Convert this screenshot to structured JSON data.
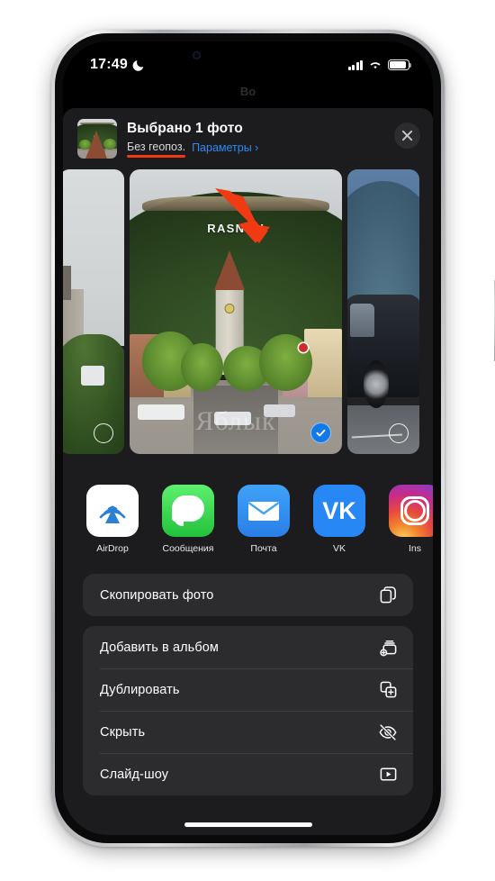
{
  "status_bar": {
    "time": "17:49",
    "dnd_icon": "moon-icon",
    "signal_icon": "cellular-signal-icon",
    "wifi_icon": "wifi-icon",
    "battery_icon": "battery-icon"
  },
  "backdrop": {
    "title": "Во"
  },
  "share_sheet": {
    "title": "Выбрано 1 фото",
    "geo_status": "Без геопоз.",
    "options_link": "Параметры ›",
    "close_icon": "close-icon",
    "thumbnail_name": "selected-photo-thumbnail"
  },
  "photo_strip": {
    "photos": [
      {
        "name": "photo-previous",
        "selected": false,
        "caption": ""
      },
      {
        "name": "photo-rasnov",
        "selected": true,
        "caption": "RASNOV",
        "watermark": "Яблык"
      },
      {
        "name": "photo-next",
        "selected": false,
        "caption": ""
      }
    ]
  },
  "apps": [
    {
      "label": "AirDrop",
      "icon": "airdrop-icon"
    },
    {
      "label": "Сообщения",
      "icon": "messages-icon"
    },
    {
      "label": "Почта",
      "icon": "mail-icon"
    },
    {
      "label": "VK",
      "icon": "vk-icon",
      "glyph": "VK"
    },
    {
      "label": "Ins",
      "icon": "instagram-icon"
    }
  ],
  "action_groups": [
    {
      "rows": [
        {
          "label": "Скопировать фото",
          "icon": "copy-icon"
        }
      ]
    },
    {
      "rows": [
        {
          "label": "Добавить в альбом",
          "icon": "add-to-album-icon"
        },
        {
          "label": "Дублировать",
          "icon": "duplicate-icon"
        },
        {
          "label": "Скрыть",
          "icon": "eye-slash-icon"
        },
        {
          "label": "Слайд-шоу",
          "icon": "slideshow-play-icon"
        }
      ]
    }
  ],
  "annotation": {
    "arrow_color": "#ef3a13",
    "underline_color": "#ef3a13"
  },
  "colors": {
    "sheet_background": "#1c1c1e",
    "row_background": "#2c2c2e",
    "accent_blue": "#2e8bf5",
    "selection_blue": "#1179e8"
  }
}
